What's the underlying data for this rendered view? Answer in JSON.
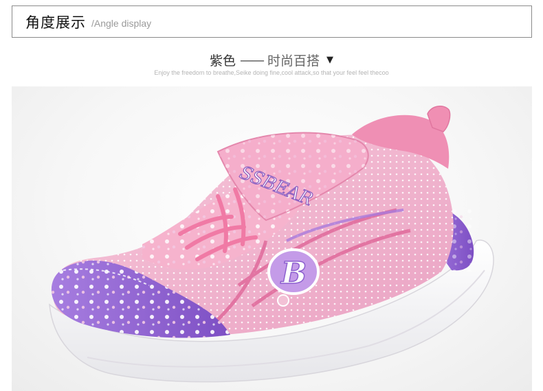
{
  "header": {
    "title": "角度展示",
    "subtitle": "/Angle display"
  },
  "caption": {
    "color_name": "紫色",
    "separator": "——",
    "style_name": "时尚百搭",
    "arrow": "▼"
  },
  "tagline": "Enjoy the freedom to breathe,Seike doing fine,cool attack,so that your feel feel thecoo",
  "photo": {
    "strap_text": "SSBEAR",
    "badge_letter": "B",
    "colors": {
      "upper_pink": "#f3b8d0",
      "lace_pink": "#f08fb3",
      "purple": "#9b68d3",
      "sole": "#ffffff"
    }
  }
}
